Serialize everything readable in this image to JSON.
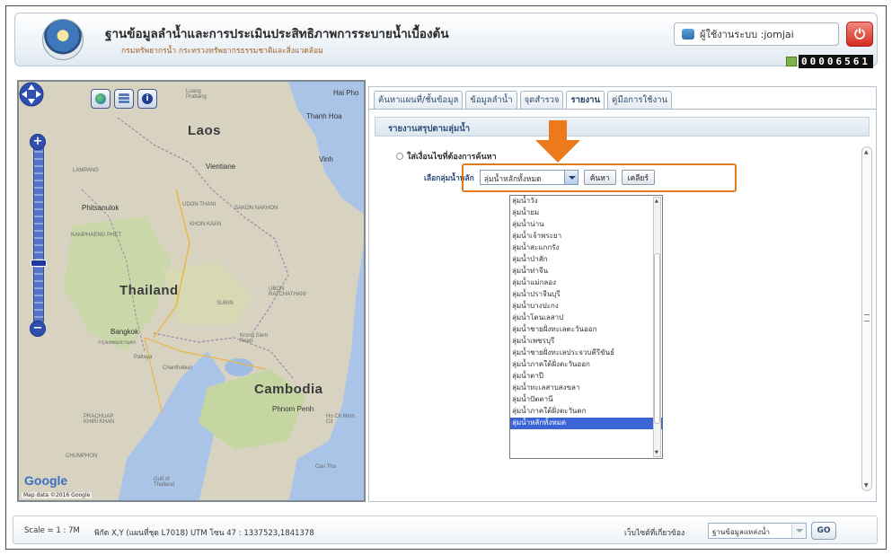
{
  "header": {
    "title": "ฐานข้อมูลลำน้ำและการประเมินประสิทธิภาพการระบายน้ำเบื้องต้น",
    "subtitle": "กรมทรัพยากรน้ำ กระทรวงทรัพยากรธรรมชาติและสิ่งแวดล้อม",
    "user_label": "ผู้ใช้งานระบบ :jomjai",
    "visitor_counter": "00006561"
  },
  "map": {
    "labels": {
      "laos": "Laos",
      "thailand": "Thailand",
      "cambodia": "Cambodia",
      "hanoi": "Hai Pho",
      "thanh_hoa": "Thanh Hoa",
      "vinh": "Vinh",
      "vientiane": "Vientiane",
      "luang": "Luang Prabang",
      "udon": "UDON THANI",
      "sakon": "SAKON NAKHON",
      "khon_kaen": "KHON KAEN",
      "phitsanulok": "Phitsanulok",
      "kamphaeng": "KAMPHAENG PHET",
      "lampang": "LAMPANG",
      "ubon": "UBON RATCHATHANI",
      "surin": "SURIN",
      "bangkok": "Bangkok",
      "bangkok_th": "กรุงเทพมหานคร",
      "pattaya": "Pattaya",
      "krong": "Krong Siem Reap",
      "chanthaburi": "Chanthaburi",
      "phnom_penh": "Phnom Penh",
      "ho_chi": "Ho Ch Minh Cit",
      "can_tho": "Can Tho",
      "prachuap": "PRACHUAP KHIRI KHAN",
      "chumphon": "CHUMPHON",
      "gulf": "Gulf of Thailand"
    },
    "google": "Google",
    "map_data": "Map data ©2016 Google"
  },
  "tabs": [
    {
      "label": "ค้นหาแผนที่/ชั้นข้อมูล",
      "active": false
    },
    {
      "label": "ข้อมูลลำน้ำ",
      "active": false
    },
    {
      "label": "จุดสำรวจ",
      "active": false
    },
    {
      "label": "รายงาน",
      "active": true
    },
    {
      "label": "คู่มือการใช้งาน",
      "active": false
    }
  ],
  "report": {
    "section_title": "รายงานสรุปตามลุ่มน้ำ",
    "search_caption": "ใส่เงื่อนไขที่ต้องการค้นหา",
    "select_label": "เลือกลุ่มน้ำหลัก",
    "select_value": "ลุ่มน้ำหลักทั้งหมด",
    "search_button": "ค้นหา",
    "clear_button": "เคลียร์",
    "options": [
      "ลุ่มน้ำวัง",
      "ลุ่มน้ำยม",
      "ลุ่มน้ำน่าน",
      "ลุ่มน้ำเจ้าพระยา",
      "ลุ่มน้ำสะแกกรัง",
      "ลุ่มน้ำป่าสัก",
      "ลุ่มน้ำท่าจีน",
      "ลุ่มน้ำแม่กลอง",
      "ลุ่มน้ำปราจีนบุรี",
      "ลุ่มน้ำบางปะกง",
      "ลุ่มน้ำโตนเลสาป",
      "ลุ่มน้ำชายฝั่งทะเลตะวันออก",
      "ลุ่มน้ำเพชรบุรี",
      "ลุ่มน้ำชายฝั่งทะเลประจวบคีรีขันธ์",
      "ลุ่มน้ำภาคใต้ฝั่งตะวันออก",
      "ลุ่มน้ำตาปี",
      "ลุ่มน้ำทะเลสาบสงขลา",
      "ลุ่มน้ำปัตตานี",
      "ลุ่มน้ำภาคใต้ฝั่งตะวันตก",
      "ลุ่มน้ำหลักทั้งหมด"
    ],
    "selected_index": 19
  },
  "status": {
    "scale": "Scale = 1 : 7M",
    "coords": "พิกัด X,Y (แผนที่ชุด L7018) UTM โซน 47 : 1337523,1841378",
    "link_label": "เว็บไซต์ที่เกี่ยวข้อง",
    "link_value": "ฐานข้อมูลแหล่งน้ำ",
    "go_label": "GO"
  },
  "colors": {
    "accent": "#e07b1a",
    "selected": "#3b64d6",
    "power": "#d42b1f"
  }
}
